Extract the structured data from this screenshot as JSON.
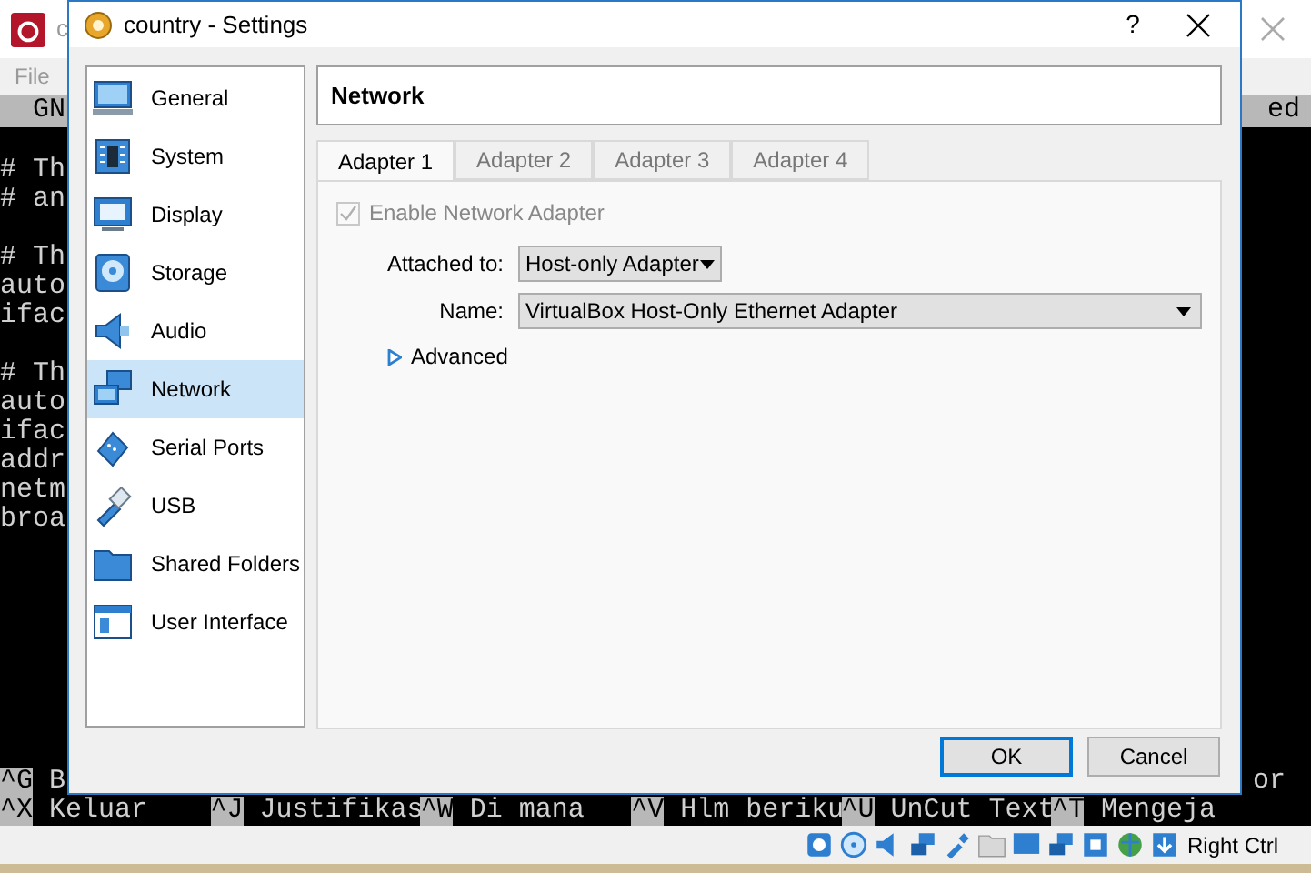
{
  "vm_window": {
    "title": "c",
    "menu": [
      "File"
    ],
    "terminal": {
      "header_left": "GN",
      "header_right": "ed",
      "blocks": [
        [
          "# Th",
          "# an"
        ],
        [
          "# Th",
          "auto",
          "ifac"
        ],
        [
          "# Th",
          "auto",
          "ifac",
          "addr",
          "netm",
          "broa"
        ]
      ],
      "shortcut_row_1": {
        "key": "^G",
        "label": "B",
        "right": "or"
      },
      "shortcut_row_2": [
        {
          "key": "^X",
          "label": "Keluar"
        },
        {
          "key": "^J",
          "label": "Justifikas"
        },
        {
          "key": "^W",
          "label": "Di mana"
        },
        {
          "key": "^V",
          "label": "Hlm beriku"
        },
        {
          "key": "^U",
          "label": "UnCut Text"
        },
        {
          "key": "^T",
          "label": "Mengeja"
        }
      ]
    },
    "status_bar": {
      "host_key": "Right Ctrl"
    }
  },
  "dialog": {
    "title": "country - Settings",
    "help": "?",
    "sidebar": [
      {
        "label": "General",
        "selected": false
      },
      {
        "label": "System",
        "selected": false
      },
      {
        "label": "Display",
        "selected": false
      },
      {
        "label": "Storage",
        "selected": false
      },
      {
        "label": "Audio",
        "selected": false
      },
      {
        "label": "Network",
        "selected": true
      },
      {
        "label": "Serial Ports",
        "selected": false
      },
      {
        "label": "USB",
        "selected": false
      },
      {
        "label": "Shared Folders",
        "selected": false
      },
      {
        "label": "User Interface",
        "selected": false
      }
    ],
    "heading": "Network",
    "tabs": [
      {
        "label": "Adapter 1",
        "selected": true
      },
      {
        "label": "Adapter 2",
        "selected": false
      },
      {
        "label": "Adapter 3",
        "selected": false
      },
      {
        "label": "Adapter 4",
        "selected": false
      }
    ],
    "enable_adapter": {
      "label": "Enable Network Adapter",
      "checked": true,
      "disabled": true
    },
    "attached_to": {
      "label": "Attached to:",
      "value": "Host-only Adapter"
    },
    "name": {
      "label": "Name:",
      "value": "VirtualBox Host-Only Ethernet Adapter"
    },
    "advanced": {
      "label": "Advanced",
      "expanded": false
    },
    "buttons": [
      {
        "label": "OK",
        "default": true
      },
      {
        "label": "Cancel",
        "default": false
      }
    ]
  }
}
